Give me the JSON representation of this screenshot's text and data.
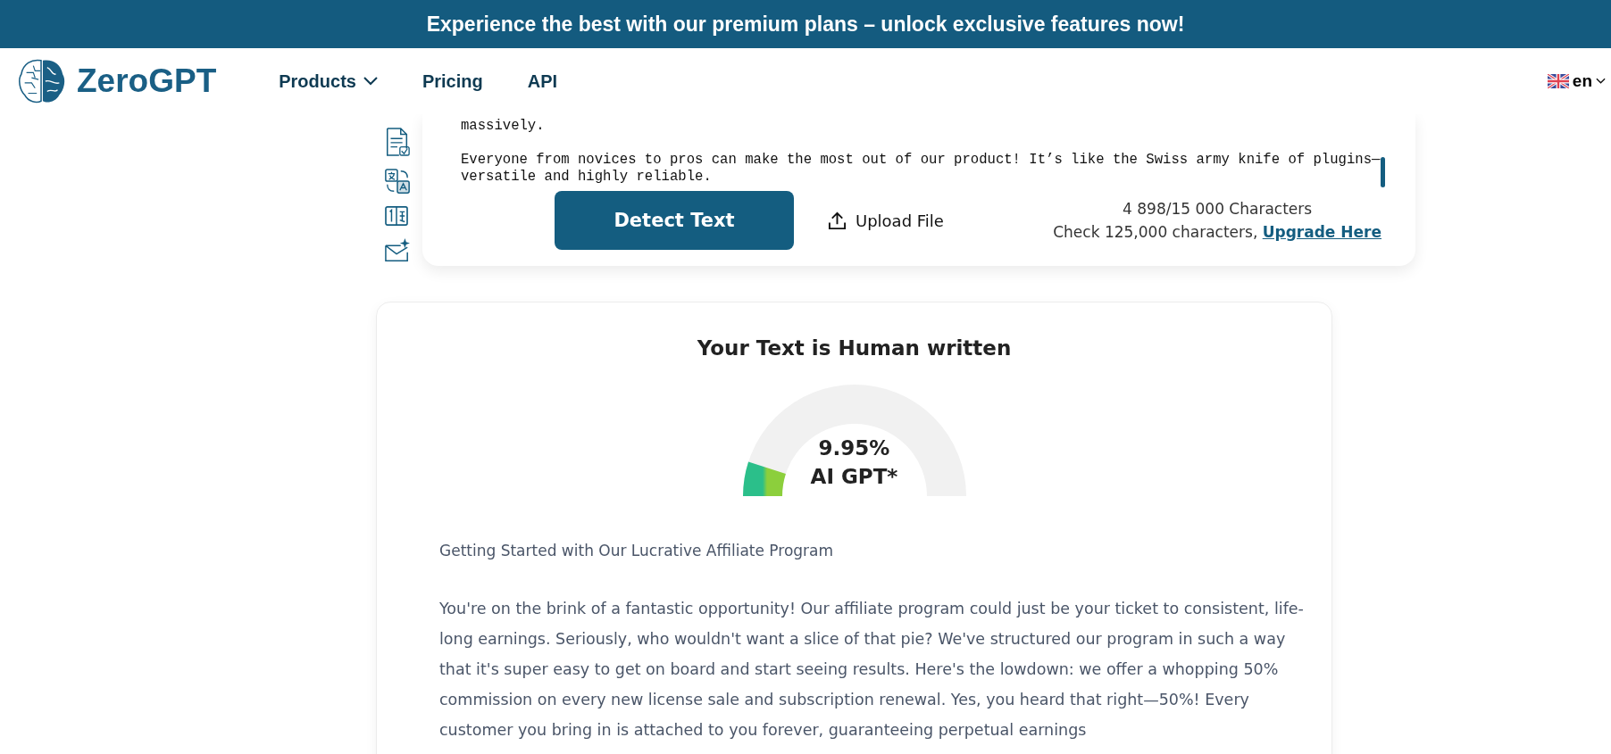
{
  "banner": {
    "text": "Experience the best with our premium plans – unlock exclusive features now!"
  },
  "nav": {
    "logo": "ZeroGPT",
    "items": [
      {
        "label": "Products",
        "has_menu": true
      },
      {
        "label": "Pricing",
        "has_menu": false
      },
      {
        "label": "API",
        "has_menu": false
      }
    ],
    "language": "en"
  },
  "editor": {
    "paragraphs": [
      [
        "massively."
      ],
      [
        "Everyone from novices to pros can make the most out of our product! It’s like the Swiss army knife of plugins—",
        "versatile and highly reliable."
      ]
    ],
    "detect_button": "Detect Text",
    "upload_button": "Upload File",
    "counter": "4 898/15 000 Characters",
    "upgrade_note": "Check 125,000 characters,",
    "upgrade_link": "Upgrade Here"
  },
  "result": {
    "title": "Your Text is Human written",
    "gauge": {
      "value": "9.95%",
      "label": "AI GPT*"
    },
    "heading": "Getting Started with Our Lucrative Affiliate Program",
    "paragraph": "You're on the brink of a fantastic opportunity! Our affiliate program could just be your ticket to consistent, life-long earnings. Seriously, who wouldn't want a slice of that pie? We've structured our program in such a way that it's super easy to get on board and start seeing results. Here's the lowdown: we offer a whopping 50% commission on every new license sale and subscription renewal. Yes, you heard that right—50%! Every customer you bring in is attached to you forever, guaranteeing perpetual earnings"
  }
}
